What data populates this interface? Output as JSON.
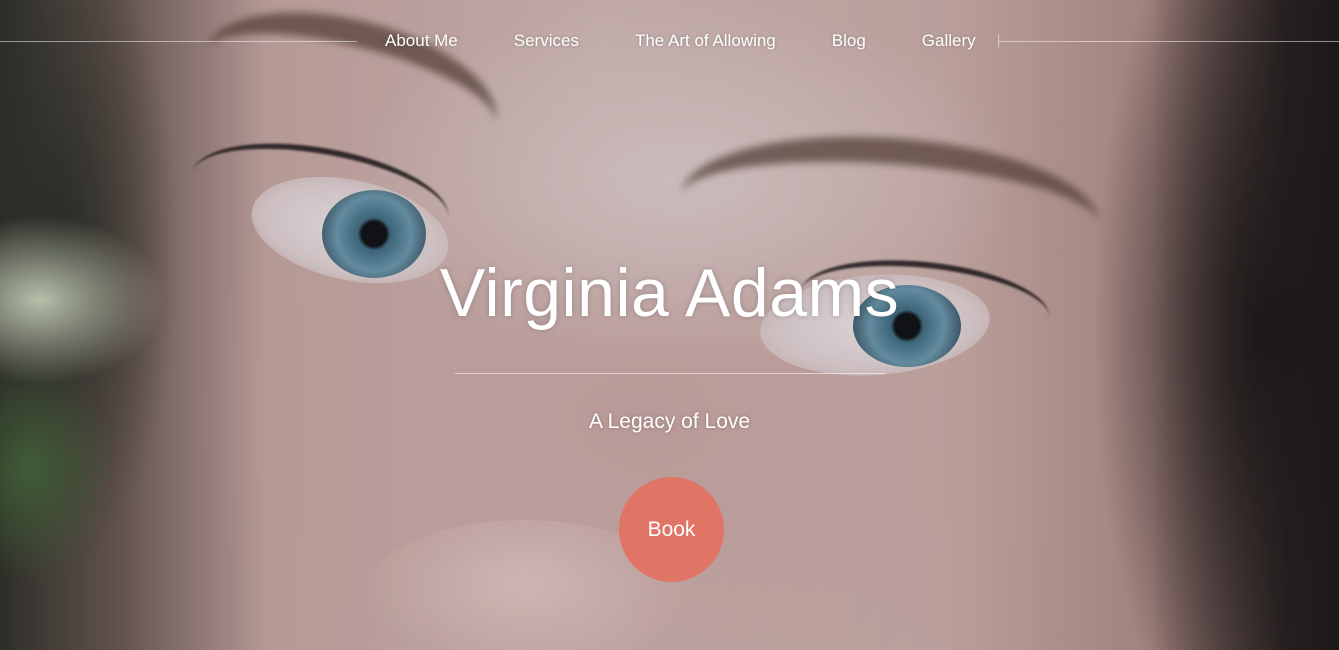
{
  "nav": {
    "items": [
      {
        "label": "About Me"
      },
      {
        "label": "Services"
      },
      {
        "label": "The Art of Allowing"
      },
      {
        "label": "Blog"
      },
      {
        "label": "Gallery"
      }
    ]
  },
  "hero": {
    "title": "Virginia Adams",
    "subtitle": "A Legacy of Love",
    "cta_label": "Book",
    "background_image": "close-up portrait of a woman's face with blue eyes"
  },
  "colors": {
    "cta": "#e07465",
    "text": "#ffffff"
  }
}
